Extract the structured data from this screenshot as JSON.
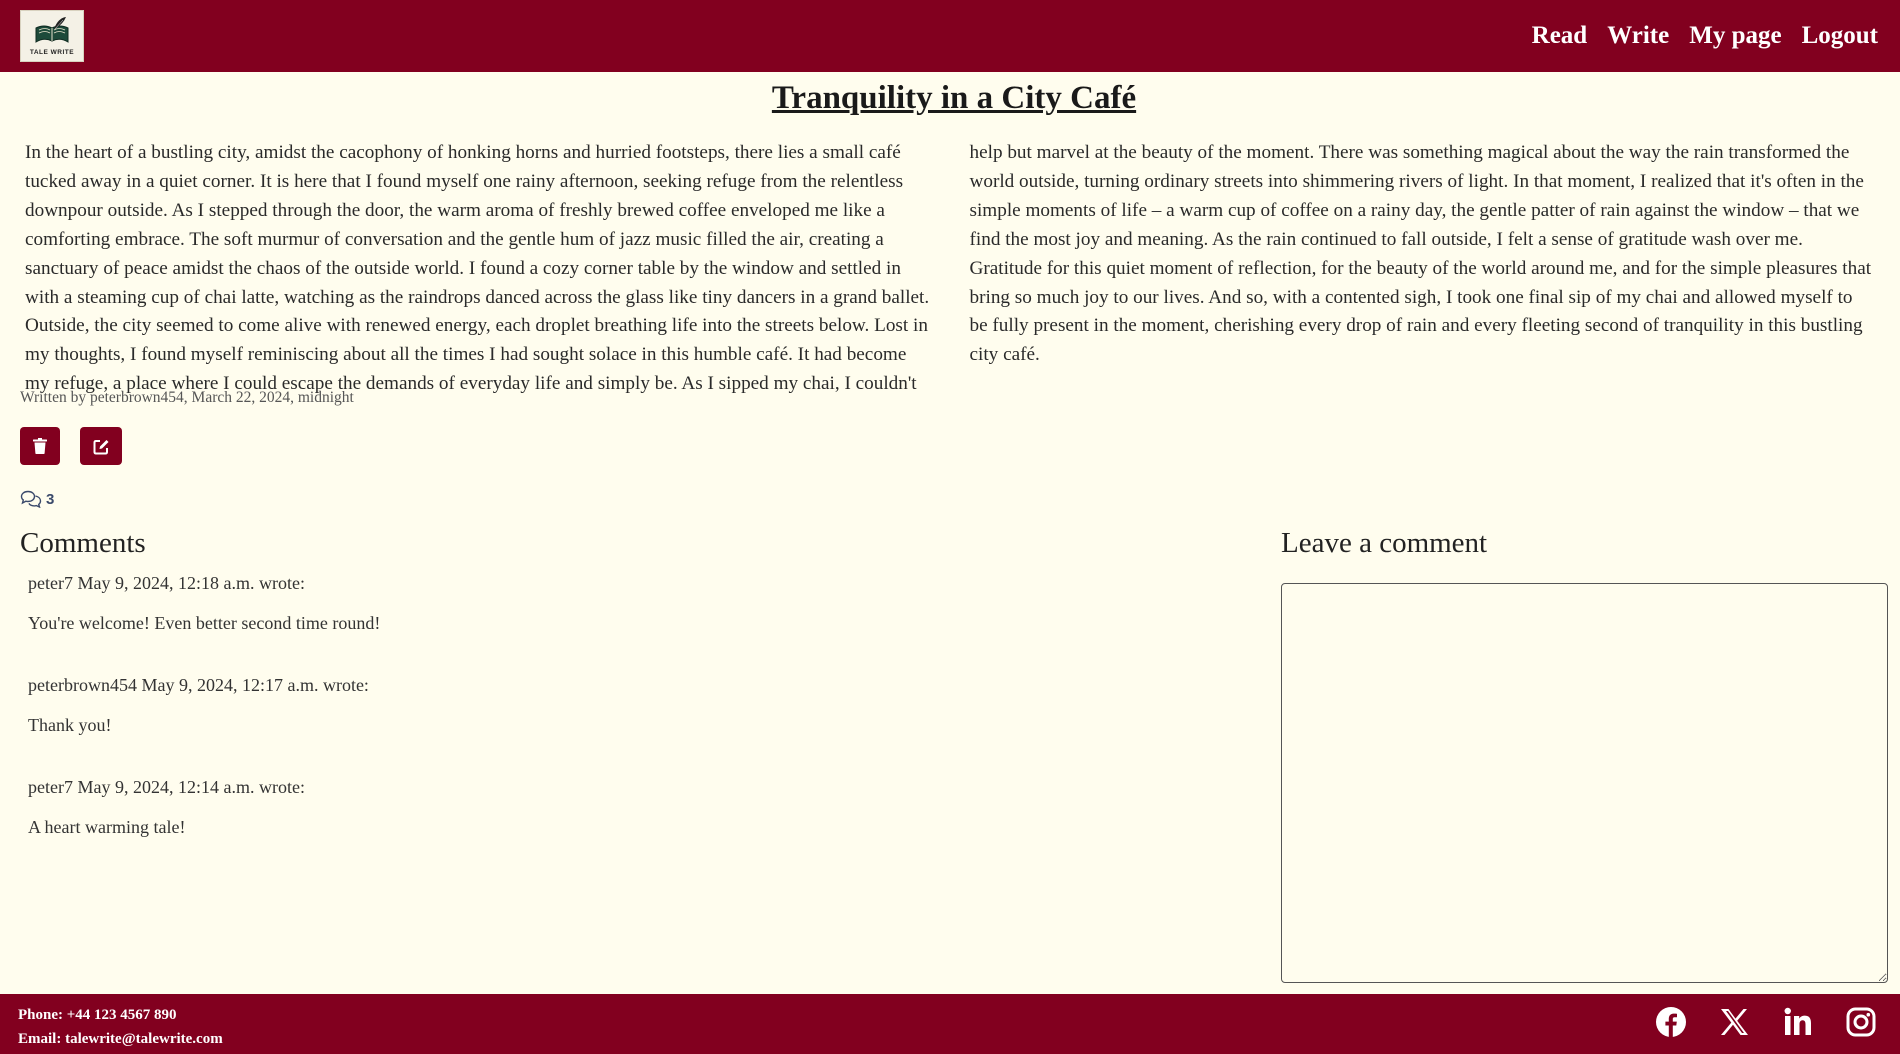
{
  "header": {
    "logo_text": "TALE WRITE",
    "nav": [
      "Read",
      "Write",
      "My page",
      "Logout"
    ]
  },
  "story": {
    "title": "Tranquility in a City Café",
    "body": "In the heart of a bustling city, amidst the cacophony of honking horns and hurried footsteps, there lies a small café tucked away in a quiet corner. It is here that I found myself one rainy afternoon, seeking refuge from the relentless downpour outside. As I stepped through the door, the warm aroma of freshly brewed coffee enveloped me like a comforting embrace. The soft murmur of conversation and the gentle hum of jazz music filled the air, creating a sanctuary of peace amidst the chaos of the outside world. I found a cozy corner table by the window and settled in with a steaming cup of chai latte, watching as the raindrops danced across the glass like tiny dancers in a grand ballet. Outside, the city seemed to come alive with renewed energy, each droplet breathing life into the streets below. Lost in my thoughts, I found myself reminiscing about all the times I had sought solace in this humble café. It had become my refuge, a place where I could escape the demands of everyday life and simply be. As I sipped my chai, I couldn't help but marvel at the beauty of the moment. There was something magical about the way the rain transformed the world outside, turning ordinary streets into shimmering rivers of light. In that moment, I realized that it's often in the simple moments of life – a warm cup of coffee on a rainy day, the gentle patter of rain against the window – that we find the most joy and meaning. As the rain continued to fall outside, I felt a sense of gratitude wash over me. Gratitude for this quiet moment of reflection, for the beauty of the world around me, and for the simple pleasures that bring so much joy to our lives. And so, with a contented sigh, I took one final sip of my chai and allowed myself to be fully present in the moment, cherishing every drop of rain and every fleeting second of tranquility in this bustling city café.",
    "byline": "Written by peterbrown454, March 22, 2024, midnight",
    "delete_icon": "trash-icon",
    "edit_icon": "edit-icon",
    "comment_count": "3"
  },
  "comments": {
    "heading": "Comments",
    "items": [
      {
        "meta": "peter7 May 9, 2024, 12:18 a.m. wrote:",
        "body": "You're welcome! Even better second time round!"
      },
      {
        "meta": "peterbrown454 May 9, 2024, 12:17 a.m. wrote:",
        "body": "Thank you!"
      },
      {
        "meta": "peter7 May 9, 2024, 12:14 a.m. wrote:",
        "body": "A heart warming tale!"
      }
    ]
  },
  "leave_comment": {
    "heading": "Leave a comment",
    "value": ""
  },
  "footer": {
    "phone": "Phone: +44 123 4567 890",
    "email": "Email: talewrite@talewrite.com",
    "social": [
      "facebook-icon",
      "x-icon",
      "linkedin-icon",
      "instagram-icon"
    ]
  },
  "colors": {
    "brand": "#82001f",
    "background": "#fffdee"
  }
}
